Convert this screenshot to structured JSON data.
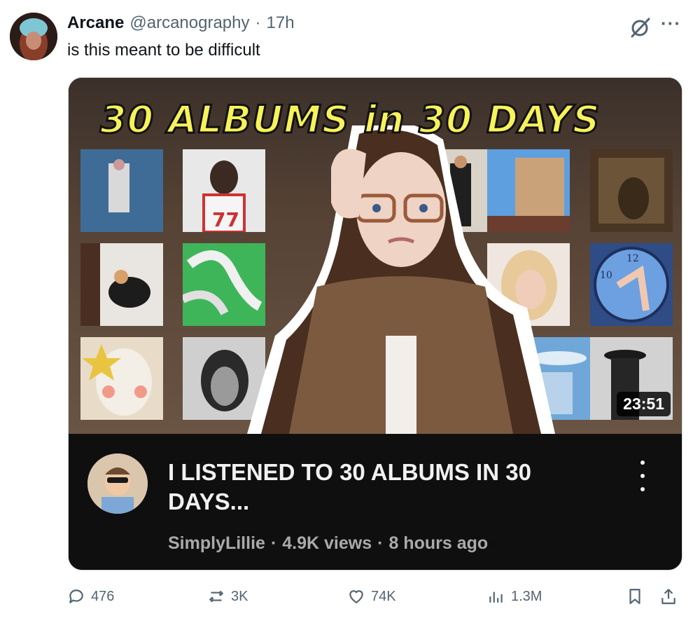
{
  "post": {
    "author_name": "Arcane",
    "handle": "@arcanography",
    "separator": "·",
    "time": "17h",
    "text": "is this meant to be difficult"
  },
  "video": {
    "thumbnail_text": "30 ALBUMS in 30 DAYS",
    "duration": "23:51",
    "title": "I LISTENED TO 30 ALBUMS IN 30 DAYS...",
    "channel": "SimplyLillie",
    "views": "4.9K views",
    "age": "8 hours ago",
    "separator": "·"
  },
  "actions": {
    "replies": "476",
    "reposts": "3K",
    "likes": "74K",
    "views": "1.3M"
  },
  "icons": {
    "more": "more-icon",
    "grok": "grok-icon",
    "reply": "reply-icon",
    "repost": "repost-icon",
    "like": "heart-icon",
    "views": "views-icon",
    "bookmark": "bookmark-icon",
    "share": "share-icon"
  },
  "colors": {
    "thumbnail_title": "#f7f25a",
    "card_background": "#0f0f0f",
    "secondary_text": "#536471"
  }
}
